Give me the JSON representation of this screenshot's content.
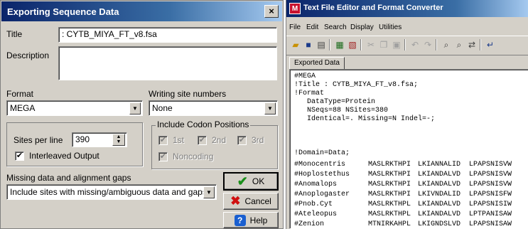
{
  "dialog": {
    "title": "Exporting Sequence Data",
    "close_label": "×",
    "title_field": {
      "label": "Title",
      "value": ": CYTB_MIYA_FT_v8.fsa"
    },
    "description": {
      "label": "Description",
      "value": ""
    },
    "format": {
      "label": "Format",
      "value": "MEGA"
    },
    "writing_site_numbers": {
      "label": "Writing site numbers",
      "value": "None"
    },
    "sites_per_line": {
      "label": "Sites per line",
      "value": "390"
    },
    "interleaved": {
      "label": "Interleaved Output",
      "checked": true
    },
    "codon_positions": {
      "title": "Include Codon Positions",
      "first": {
        "label": "1st",
        "checked": true,
        "enabled": false
      },
      "second": {
        "label": "2nd",
        "checked": true,
        "enabled": false
      },
      "third": {
        "label": "3rd",
        "checked": true,
        "enabled": false
      },
      "noncoding": {
        "label": "Noncoding",
        "checked": true,
        "enabled": false
      }
    },
    "missing_gaps": {
      "label": "Missing data and alignment gaps",
      "value": "Include sites with missing/ambiguous data and gaps"
    },
    "buttons": {
      "ok": "OK",
      "cancel": "Cancel",
      "help": "Help"
    }
  },
  "editor_window": {
    "app_icon": "M",
    "title": "Text File Editor and Format Converter",
    "menu": [
      "File",
      "Edit",
      "Search",
      "Display",
      "Utilities"
    ],
    "toolbar_icons": [
      "open-folder-icon",
      "save-icon",
      "print-icon",
      "format-convert-icon",
      "new-file-icon",
      "cut-icon",
      "copy-icon",
      "paste-icon",
      "undo-icon",
      "redo-icon",
      "find-icon",
      "find-next-icon",
      "replace-icon",
      "wrap-icon"
    ],
    "tab_label": "Exported Data",
    "lines": [
      "#MEGA",
      "!Title : CYTB_MIYA_FT_v8.fsa;",
      "!Format",
      "   DataType=Protein",
      "   NSeqs=88 NSites=380",
      "   Identical=. Missing=N Indel=-;",
      "",
      "",
      "!Domain=Data;"
    ],
    "sequences": [
      {
        "name": "#Monocentris",
        "s1": "MASLRKTHPI",
        "s2": "LKIANNALID",
        "s3": "LPAPSNISVW"
      },
      {
        "name": "#Hoplostethus",
        "s1": "MASLRKTHPI",
        "s2": "LKIANDALVD",
        "s3": "LPAPSNISVW"
      },
      {
        "name": "#Anomalops",
        "s1": "MASLRKTHPI",
        "s2": "LKIANDALVD",
        "s3": "LPAPSNISVW"
      },
      {
        "name": "#Anoplogaster",
        "s1": "MASLRKTHPI",
        "s2": "LKIVNDALID",
        "s3": "LPAPSNISFW"
      },
      {
        "name": "#Pnob.Cyt",
        "s1": "MASLRKTHPL",
        "s2": "LKIANDALVD",
        "s3": "LPAPSNISIW"
      },
      {
        "name": "#Ateleopus",
        "s1": "MASLRKTHPL",
        "s2": "LKIANDALVD",
        "s3": "LPTPANISAW"
      },
      {
        "name": "#Zenion",
        "s1": "MTNIRKAHPL",
        "s2": "LKIGNDSLVD",
        "s3": "LPAPSNISAW"
      }
    ]
  }
}
